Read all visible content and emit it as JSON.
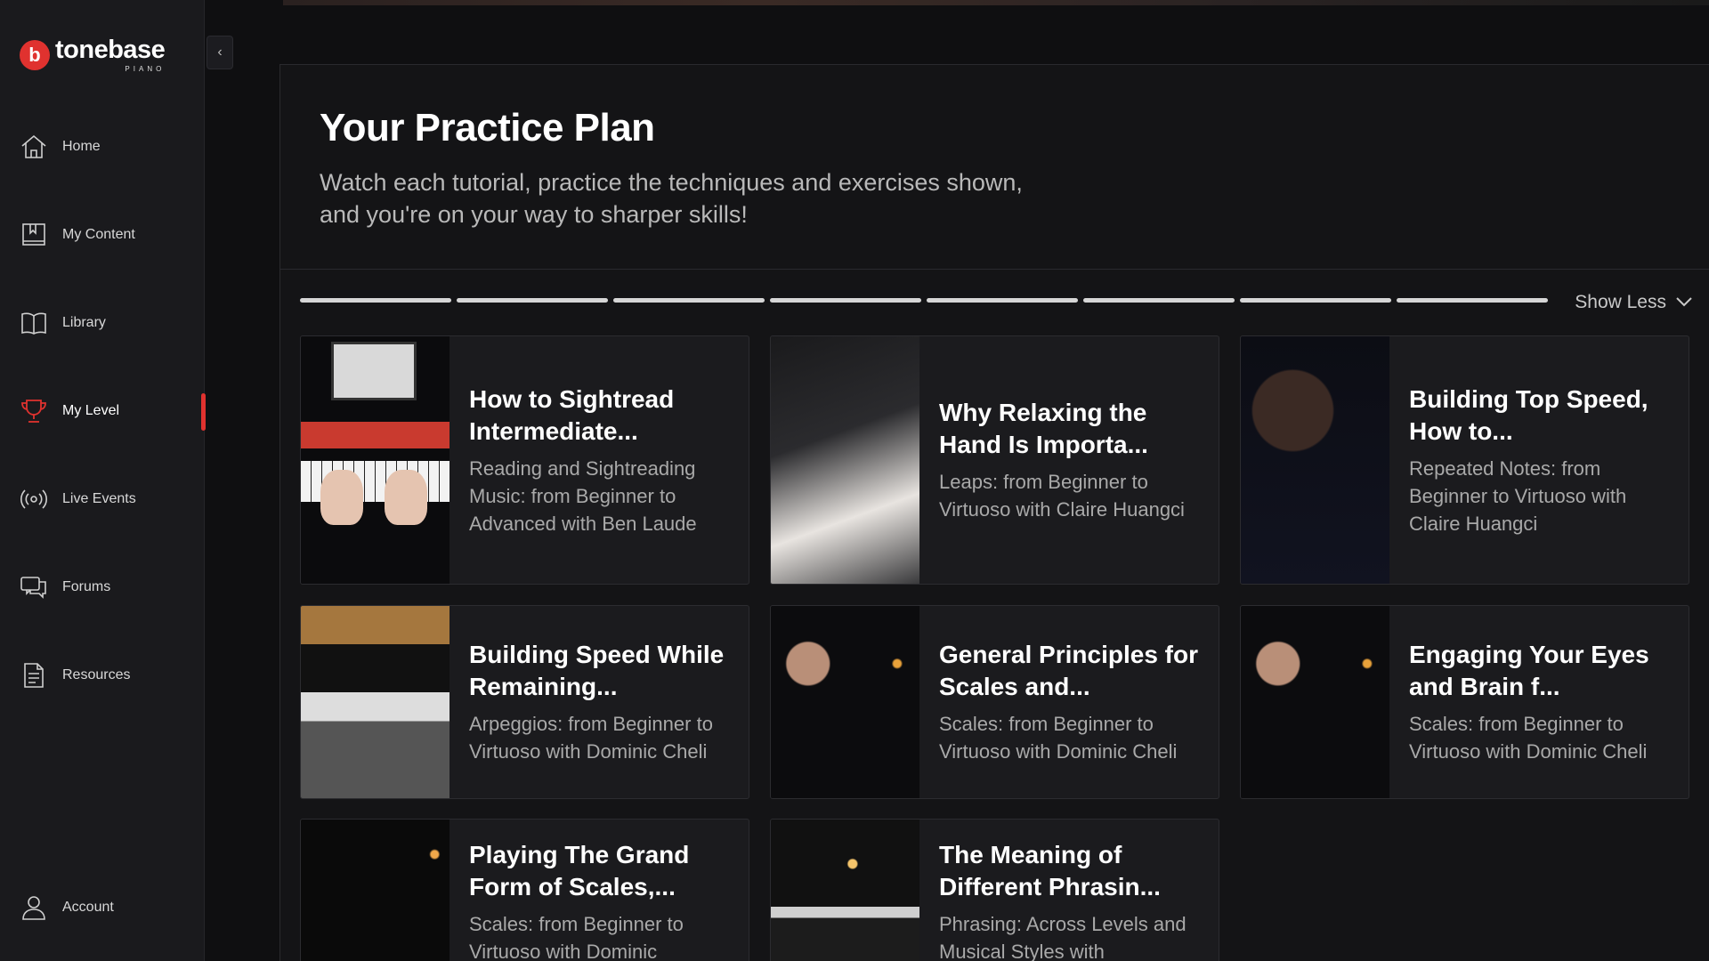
{
  "brand": {
    "name": "tonebase",
    "sub": "PIANO",
    "mark": "b",
    "accent": "#e0322f"
  },
  "sidebar": {
    "items": [
      {
        "label": "Home",
        "icon": "home-icon"
      },
      {
        "label": "My Content",
        "icon": "bookmark-book-icon"
      },
      {
        "label": "Library",
        "icon": "book-icon"
      },
      {
        "label": "My Level",
        "icon": "trophy-icon",
        "active": true
      },
      {
        "label": "Live Events",
        "icon": "broadcast-icon"
      },
      {
        "label": "Forums",
        "icon": "chat-icon"
      },
      {
        "label": "Resources",
        "icon": "document-icon"
      }
    ],
    "account": {
      "label": "Account",
      "icon": "user-icon"
    },
    "collapse_glyph": "‹"
  },
  "plan": {
    "title": "Your Practice Plan",
    "subtitle": "Watch each tutorial, practice the techniques and exercises shown, and you're on your way to sharper skills!",
    "progress_segments": 8,
    "toggle_label": "Show Less"
  },
  "cards": [
    {
      "title": "How to Sightread Intermediate...",
      "desc": "Reading and Sightreading Music: from Beginner to Advanced with Ben Laude"
    },
    {
      "title": "Why Relaxing the Hand Is Importa...",
      "desc": "Leaps: from Beginner to Virtuoso with Claire Huangci"
    },
    {
      "title": "Building Top Speed, How to...",
      "desc": "Repeated Notes: from Beginner to Virtuoso with Claire Huangci"
    },
    {
      "title": "Building Speed While Remaining...",
      "desc": "Arpeggios: from Beginner to Virtuoso with Dominic Cheli"
    },
    {
      "title": "General Principles for Scales and...",
      "desc": "Scales: from Beginner to Virtuoso with Dominic Cheli"
    },
    {
      "title": "Engaging Your Eyes and Brain f...",
      "desc": "Scales: from Beginner to Virtuoso with Dominic Cheli"
    },
    {
      "title": "Playing The Grand Form of Scales,...",
      "desc": "Scales: from Beginner to Virtuoso with Dominic"
    },
    {
      "title": "The Meaning of Different Phrasin...",
      "desc": "Phrasing: Across Levels and Musical Styles with"
    }
  ]
}
